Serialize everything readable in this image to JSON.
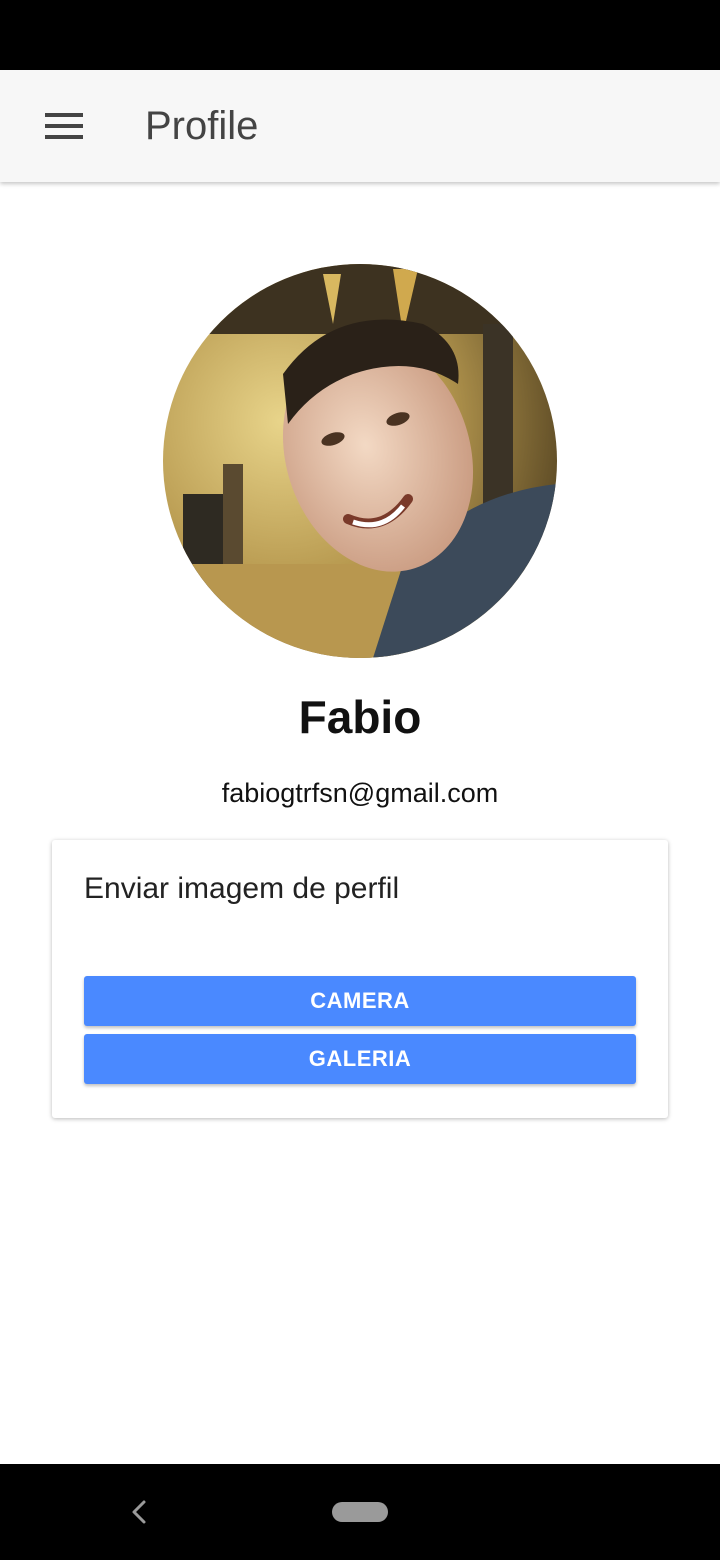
{
  "app_bar": {
    "title": "Profile",
    "menu_icon": "hamburger-menu-icon"
  },
  "profile": {
    "name": "Fabio",
    "email": "fabiogtrfsn@gmail.com"
  },
  "upload_card": {
    "title": "Enviar imagem de perfil",
    "camera_label": "CAMERA",
    "gallery_label": "GALERIA"
  },
  "nav_bar": {
    "back_icon": "back-chevron-icon",
    "home_icon": "home-pill-icon"
  },
  "colors": {
    "button": "#4a89ff",
    "app_bar": "#f7f7f7",
    "title_text": "#444444"
  }
}
